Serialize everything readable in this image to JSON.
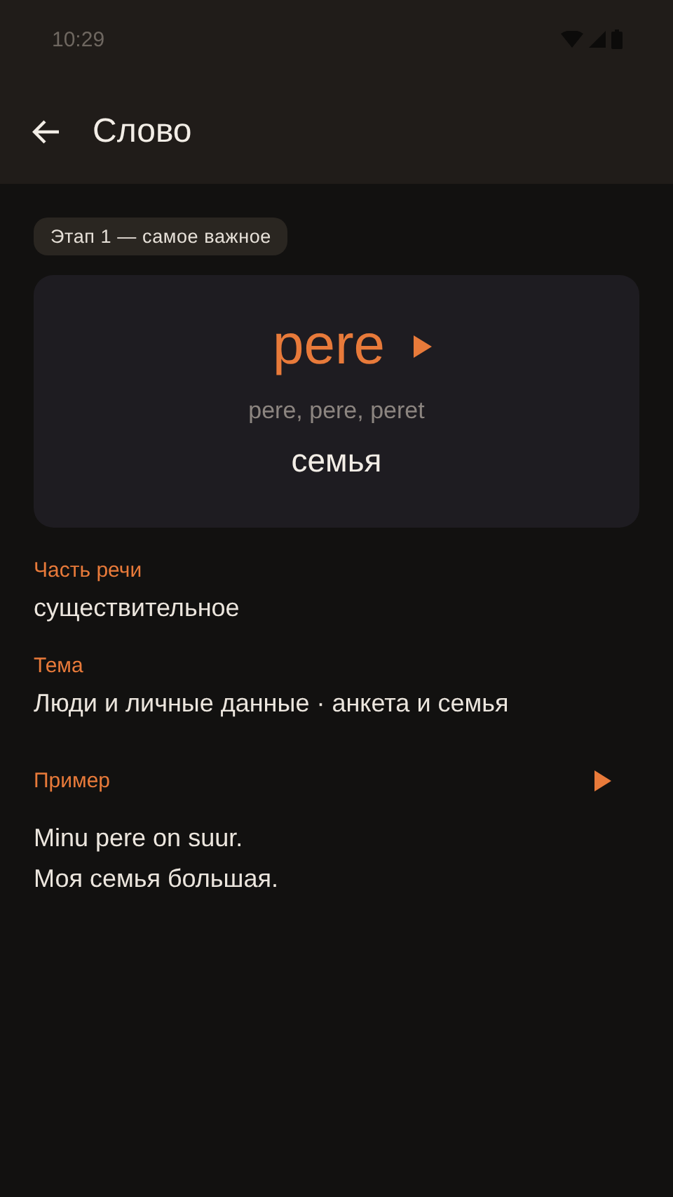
{
  "status_bar": {
    "time": "10:29"
  },
  "app_bar": {
    "title": "Слово"
  },
  "stage_chip": "Этап 1 — самое важное",
  "word_card": {
    "word": "pere",
    "forms": "pere, pere, peret",
    "translation": "семья"
  },
  "fields": [
    {
      "label": "Часть речи",
      "value": "существительное"
    },
    {
      "label": "Тема",
      "value": "Люди и личные данные · анкета и семья"
    }
  ],
  "example": {
    "label": "Пример",
    "lines": [
      "Minu pere on suur.",
      "Моя семья большая."
    ]
  }
}
